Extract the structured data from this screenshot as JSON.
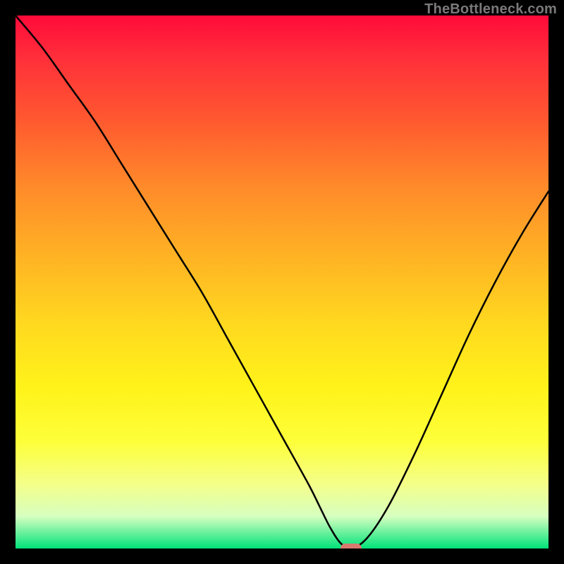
{
  "attribution": "TheBottleneck.com",
  "colors": {
    "frame": "#000000",
    "curve": "#000000",
    "marker": "#d97a6f",
    "gradient_top": "#ff0a3a",
    "gradient_bottom": "#00e37a"
  },
  "chart_data": {
    "type": "line",
    "title": "",
    "xlabel": "",
    "ylabel": "",
    "xlim": [
      0,
      100
    ],
    "ylim": [
      0,
      100
    ],
    "grid": false,
    "legend": false,
    "series": [
      {
        "name": "bottleneck-curve",
        "x": [
          0,
          5,
          10,
          15,
          20,
          25,
          30,
          35,
          40,
          45,
          50,
          55,
          57,
          59,
          61,
          63,
          66,
          70,
          75,
          80,
          85,
          90,
          95,
          100
        ],
        "values": [
          100,
          94,
          87,
          80,
          72,
          64,
          56,
          48,
          39,
          30,
          21,
          12,
          8,
          4,
          1,
          0,
          2,
          8,
          18,
          29,
          40,
          50,
          59,
          67
        ]
      }
    ],
    "marker": {
      "x": 63,
      "y": 0
    },
    "background": "red-yellow-green vertical gradient (red top, green bottom)"
  }
}
